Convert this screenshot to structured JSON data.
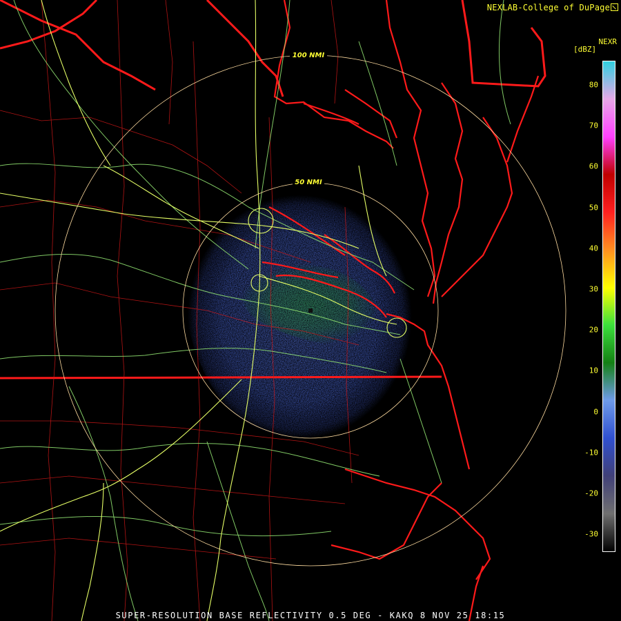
{
  "header": {
    "credit": "NEXLAB-College of DuPage",
    "credit_icon": "external-link-icon"
  },
  "colorbar": {
    "product": "NEXR",
    "units": "[dBZ]",
    "ticks": [
      "80",
      "70",
      "60",
      "50",
      "40",
      "30",
      "20",
      "10",
      "0",
      "-10",
      "-20",
      "-30"
    ],
    "stops": [
      "#000000",
      "#707070",
      "#404078",
      "#3050d0",
      "#6f9bea",
      "#148014",
      "#3ce03c",
      "#ffff00",
      "#ff9020",
      "#ff2020",
      "#c00000",
      "#ff40ff",
      "#e6a8e6",
      "#30d0e0"
    ]
  },
  "map": {
    "range_rings": [
      {
        "label": "50 NMI"
      },
      {
        "label": "100 NMI"
      }
    ],
    "colors": {
      "state_border": "#ff1a1a",
      "county_border": "#d01818",
      "highway": "#e6ff66",
      "road": "#90e070",
      "ring": "#ffdca0",
      "echo_weak": "#4a68d8",
      "echo_moderate": "#1d8a1d"
    }
  },
  "footer": {
    "title": "SUPER-RESOLUTION BASE REFLECTIVITY 0.5 DEG - KAKQ 8 NOV 25 18:15"
  }
}
